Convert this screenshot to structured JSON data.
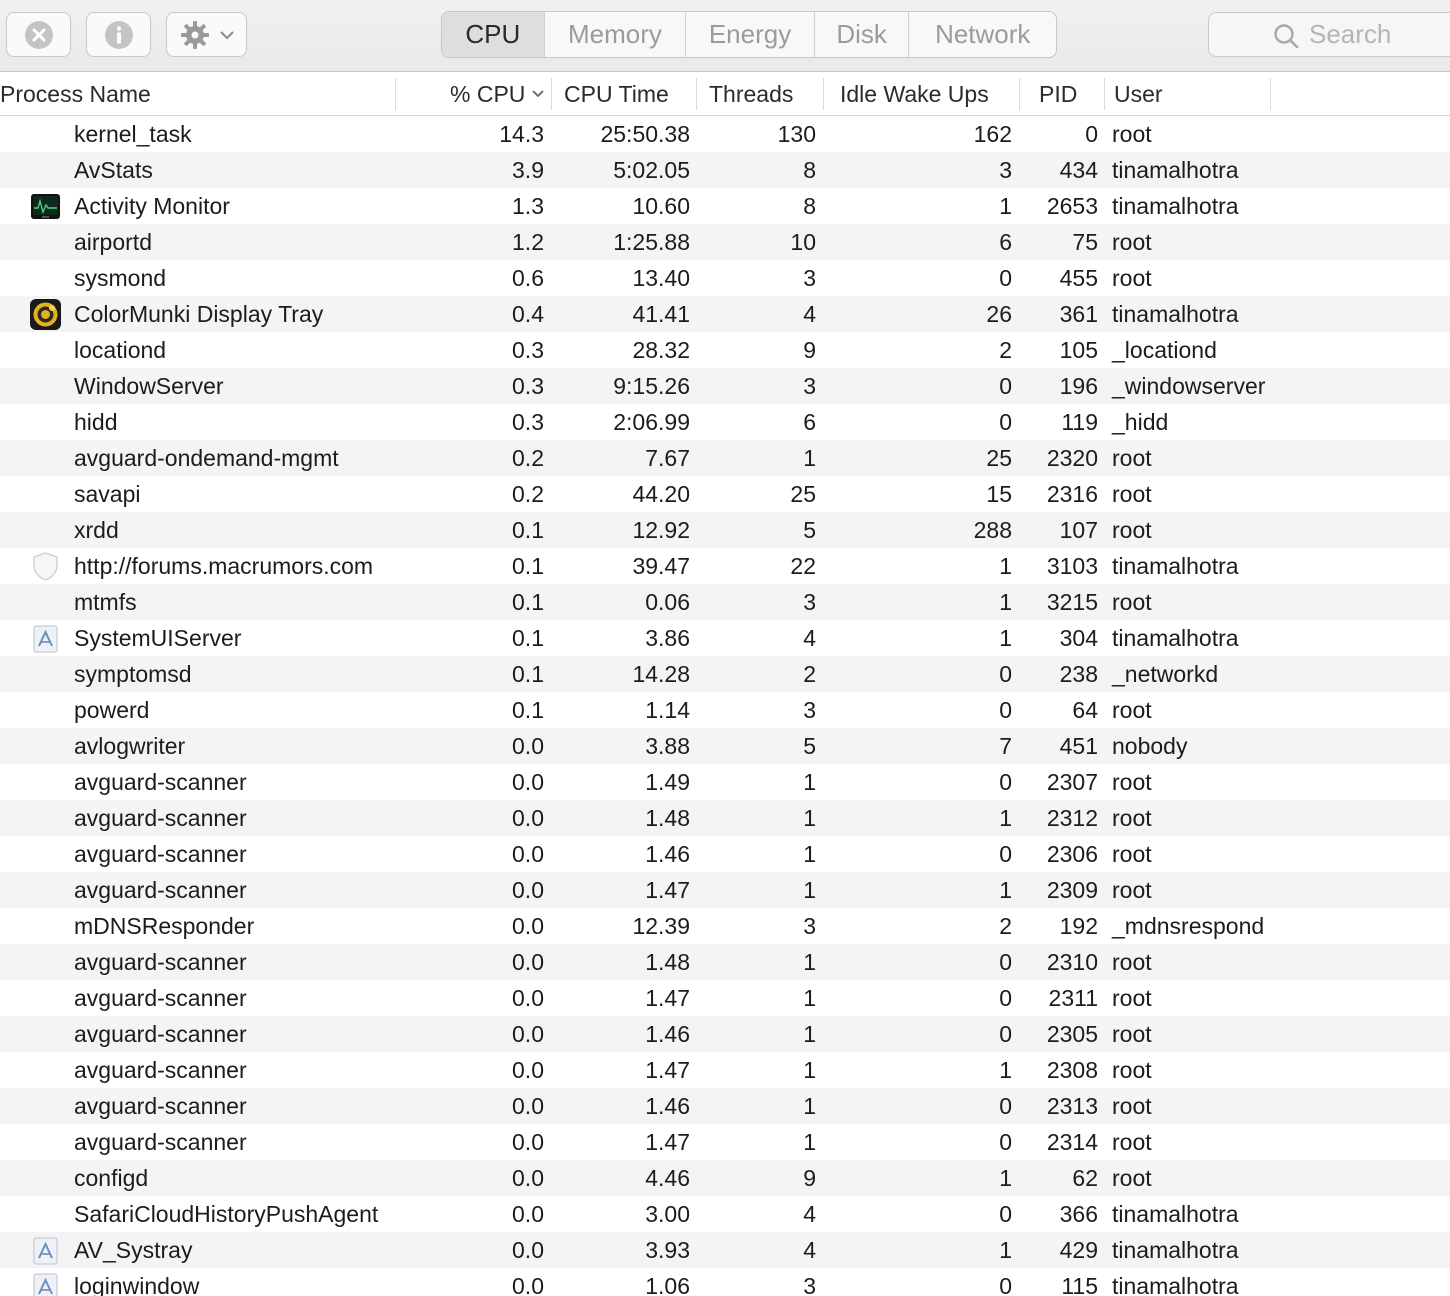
{
  "toolbar": {
    "buttons": [
      {
        "name": "close-process-button",
        "icon": "x-circle-icon"
      },
      {
        "name": "info-button",
        "icon": "info-icon"
      },
      {
        "name": "action-menu-button",
        "icon": "gear-icon"
      }
    ],
    "tabs": [
      "CPU",
      "Memory",
      "Energy",
      "Disk",
      "Network"
    ],
    "active_tab": "CPU",
    "search": {
      "placeholder": "Search"
    }
  },
  "columns": {
    "process_name": "Process Name",
    "cpu": "% CPU",
    "cpu_time": "CPU Time",
    "threads": "Threads",
    "idle_wake_ups": "Idle Wake Ups",
    "pid": "PID",
    "user": "User"
  },
  "rows": [
    {
      "icon": "",
      "name": "kernel_task",
      "cpu": "14.3",
      "time": "25:50.38",
      "threads": "130",
      "idle": "162",
      "pid": "0",
      "user": "root"
    },
    {
      "icon": "",
      "name": "AvStats",
      "cpu": "3.9",
      "time": "5:02.05",
      "threads": "8",
      "idle": "3",
      "pid": "434",
      "user": "tinamalhotra"
    },
    {
      "icon": "activity-monitor-icon",
      "name": "Activity Monitor",
      "cpu": "1.3",
      "time": "10.60",
      "threads": "8",
      "idle": "1",
      "pid": "2653",
      "user": "tinamalhotra"
    },
    {
      "icon": "",
      "name": "airportd",
      "cpu": "1.2",
      "time": "1:25.88",
      "threads": "10",
      "idle": "6",
      "pid": "75",
      "user": "root"
    },
    {
      "icon": "",
      "name": "sysmond",
      "cpu": "0.6",
      "time": "13.40",
      "threads": "3",
      "idle": "0",
      "pid": "455",
      "user": "root"
    },
    {
      "icon": "colormunki-icon",
      "name": "ColorMunki Display Tray",
      "cpu": "0.4",
      "time": "41.41",
      "threads": "4",
      "idle": "26",
      "pid": "361",
      "user": "tinamalhotra"
    },
    {
      "icon": "",
      "name": "locationd",
      "cpu": "0.3",
      "time": "28.32",
      "threads": "9",
      "idle": "2",
      "pid": "105",
      "user": "_locationd"
    },
    {
      "icon": "",
      "name": "WindowServer",
      "cpu": "0.3",
      "time": "9:15.26",
      "threads": "3",
      "idle": "0",
      "pid": "196",
      "user": "_windowserver"
    },
    {
      "icon": "",
      "name": "hidd",
      "cpu": "0.3",
      "time": "2:06.99",
      "threads": "6",
      "idle": "0",
      "pid": "119",
      "user": "_hidd"
    },
    {
      "icon": "",
      "name": "avguard-ondemand-mgmt",
      "cpu": "0.2",
      "time": "7.67",
      "threads": "1",
      "idle": "25",
      "pid": "2320",
      "user": "root"
    },
    {
      "icon": "",
      "name": "savapi",
      "cpu": "0.2",
      "time": "44.20",
      "threads": "25",
      "idle": "15",
      "pid": "2316",
      "user": "root"
    },
    {
      "icon": "",
      "name": "xrdd",
      "cpu": "0.1",
      "time": "12.92",
      "threads": "5",
      "idle": "288",
      "pid": "107",
      "user": "root"
    },
    {
      "icon": "shield-icon",
      "name": "http://forums.macrumors.com",
      "cpu": "0.1",
      "time": "39.47",
      "threads": "22",
      "idle": "1",
      "pid": "3103",
      "user": "tinamalhotra"
    },
    {
      "icon": "",
      "name": "mtmfs",
      "cpu": "0.1",
      "time": "0.06",
      "threads": "3",
      "idle": "1",
      "pid": "3215",
      "user": "root"
    },
    {
      "icon": "generic-app-icon",
      "name": "SystemUIServer",
      "cpu": "0.1",
      "time": "3.86",
      "threads": "4",
      "idle": "1",
      "pid": "304",
      "user": "tinamalhotra"
    },
    {
      "icon": "",
      "name": "symptomsd",
      "cpu": "0.1",
      "time": "14.28",
      "threads": "2",
      "idle": "0",
      "pid": "238",
      "user": "_networkd"
    },
    {
      "icon": "",
      "name": "powerd",
      "cpu": "0.1",
      "time": "1.14",
      "threads": "3",
      "idle": "0",
      "pid": "64",
      "user": "root"
    },
    {
      "icon": "",
      "name": "avlogwriter",
      "cpu": "0.0",
      "time": "3.88",
      "threads": "5",
      "idle": "7",
      "pid": "451",
      "user": "nobody"
    },
    {
      "icon": "",
      "name": "avguard-scanner",
      "cpu": "0.0",
      "time": "1.49",
      "threads": "1",
      "idle": "0",
      "pid": "2307",
      "user": "root"
    },
    {
      "icon": "",
      "name": "avguard-scanner",
      "cpu": "0.0",
      "time": "1.48",
      "threads": "1",
      "idle": "1",
      "pid": "2312",
      "user": "root"
    },
    {
      "icon": "",
      "name": "avguard-scanner",
      "cpu": "0.0",
      "time": "1.46",
      "threads": "1",
      "idle": "0",
      "pid": "2306",
      "user": "root"
    },
    {
      "icon": "",
      "name": "avguard-scanner",
      "cpu": "0.0",
      "time": "1.47",
      "threads": "1",
      "idle": "1",
      "pid": "2309",
      "user": "root"
    },
    {
      "icon": "",
      "name": "mDNSResponder",
      "cpu": "0.0",
      "time": "12.39",
      "threads": "3",
      "idle": "2",
      "pid": "192",
      "user": "_mdnsrespond"
    },
    {
      "icon": "",
      "name": "avguard-scanner",
      "cpu": "0.0",
      "time": "1.48",
      "threads": "1",
      "idle": "0",
      "pid": "2310",
      "user": "root"
    },
    {
      "icon": "",
      "name": "avguard-scanner",
      "cpu": "0.0",
      "time": "1.47",
      "threads": "1",
      "idle": "0",
      "pid": "2311",
      "user": "root"
    },
    {
      "icon": "",
      "name": "avguard-scanner",
      "cpu": "0.0",
      "time": "1.46",
      "threads": "1",
      "idle": "0",
      "pid": "2305",
      "user": "root"
    },
    {
      "icon": "",
      "name": "avguard-scanner",
      "cpu": "0.0",
      "time": "1.47",
      "threads": "1",
      "idle": "1",
      "pid": "2308",
      "user": "root"
    },
    {
      "icon": "",
      "name": "avguard-scanner",
      "cpu": "0.0",
      "time": "1.46",
      "threads": "1",
      "idle": "0",
      "pid": "2313",
      "user": "root"
    },
    {
      "icon": "",
      "name": "avguard-scanner",
      "cpu": "0.0",
      "time": "1.47",
      "threads": "1",
      "idle": "0",
      "pid": "2314",
      "user": "root"
    },
    {
      "icon": "",
      "name": "configd",
      "cpu": "0.0",
      "time": "4.46",
      "threads": "9",
      "idle": "1",
      "pid": "62",
      "user": "root"
    },
    {
      "icon": "",
      "name": "SafariCloudHistoryPushAgent",
      "cpu": "0.0",
      "time": "3.00",
      "threads": "4",
      "idle": "0",
      "pid": "366",
      "user": "tinamalhotra"
    },
    {
      "icon": "generic-app-icon",
      "name": "AV_Systray",
      "cpu": "0.0",
      "time": "3.93",
      "threads": "4",
      "idle": "1",
      "pid": "429",
      "user": "tinamalhotra"
    },
    {
      "icon": "generic-app-icon",
      "name": "loginwindow",
      "cpu": "0.0",
      "time": "1.06",
      "threads": "3",
      "idle": "0",
      "pid": "115",
      "user": "tinamalhotra"
    }
  ]
}
